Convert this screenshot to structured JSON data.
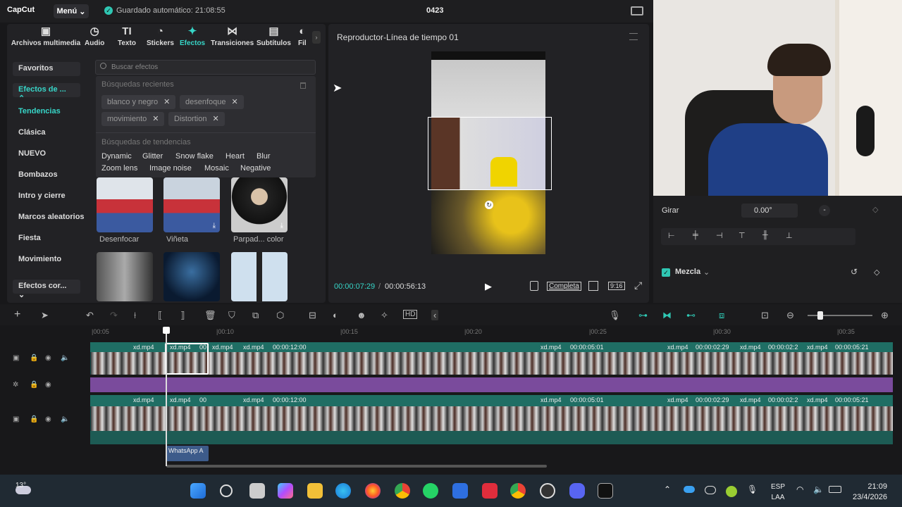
{
  "topbar": {
    "logo": "CapCut",
    "menu": "Menú",
    "autosave": "Guardado automático: 21:08:55",
    "project": "0423"
  },
  "tabs": [
    {
      "label": "Archivos multimedia",
      "icon": "media-icon",
      "glyph": "▣"
    },
    {
      "label": "Audio",
      "icon": "audio-icon",
      "glyph": "◷"
    },
    {
      "label": "Texto",
      "icon": "text-icon",
      "glyph": "TI"
    },
    {
      "label": "Stickers",
      "icon": "sticker-icon",
      "glyph": "◔"
    },
    {
      "label": "Efectos",
      "icon": "effects-icon",
      "glyph": "✦"
    },
    {
      "label": "Transiciones",
      "icon": "transition-icon",
      "glyph": "⋈"
    },
    {
      "label": "Subtítulos",
      "icon": "subtitle-icon",
      "glyph": "▤"
    },
    {
      "label": "Fil",
      "icon": "filter-icon",
      "glyph": "◐"
    }
  ],
  "categories": {
    "favorites": "Favoritos",
    "effects_de": "Efectos de ...",
    "items": [
      "Tendencias",
      "Clásica",
      "NUEVO",
      "Bombazos",
      "Intro y cierre",
      "Marcos aleatorios",
      "Fiesta",
      "Movimiento"
    ],
    "bottom": "Efectos cor..."
  },
  "search": {
    "placeholder": "Buscar efectos"
  },
  "dropdown": {
    "recent_title": "Búsquedas recientes",
    "recent": [
      "blanco y negro",
      "desenfoque",
      "movimiento",
      "Distortion"
    ],
    "trend_title": "Búsquedas de tendencias",
    "trends_row1": [
      "Dynamic",
      "Glitter",
      "Snow flake",
      "Heart",
      "Blur"
    ],
    "trends_row2": [
      "Zoom lens",
      "Image noise",
      "Mosaic",
      "Negative"
    ]
  },
  "thumbs": [
    "Desenfocar",
    "Viñeta",
    "Parpad... color"
  ],
  "player": {
    "title": "Reproductor-Línea de tiempo 01",
    "time_current": "00:00:07:29",
    "time_total": "00:00:56:13",
    "full": "Completa",
    "ratio": "9:16"
  },
  "props": {
    "rotate_label": "Girar",
    "rotate_value": "0.00°",
    "blend_label": "Mezcla"
  },
  "ruler": [
    "|00:05",
    "|00:10",
    "|00:15",
    "|00:20",
    "|00:25",
    "|00:30",
    "|00:35"
  ],
  "clips": [
    "xd.mp4",
    "xd.mp4",
    "00",
    "xd.mp4",
    "00:00:12:00",
    "xd.mp4",
    "00:00:05:01",
    "xd.mp4",
    "00:00:02:29",
    "xd.mp4",
    "00:00:02:2",
    "xd.mp4",
    "00:00:05:21"
  ],
  "audio_clip": "WhatsApp A",
  "taskbar": {
    "temp": "13°",
    "lang1": "ESP",
    "lang2": "LAA",
    "time": "21:09",
    "date": "23/4/2026"
  },
  "colors": {
    "accent": "#37d6c8",
    "clip": "#27766c",
    "effect_bar": "#7a4b9c"
  }
}
